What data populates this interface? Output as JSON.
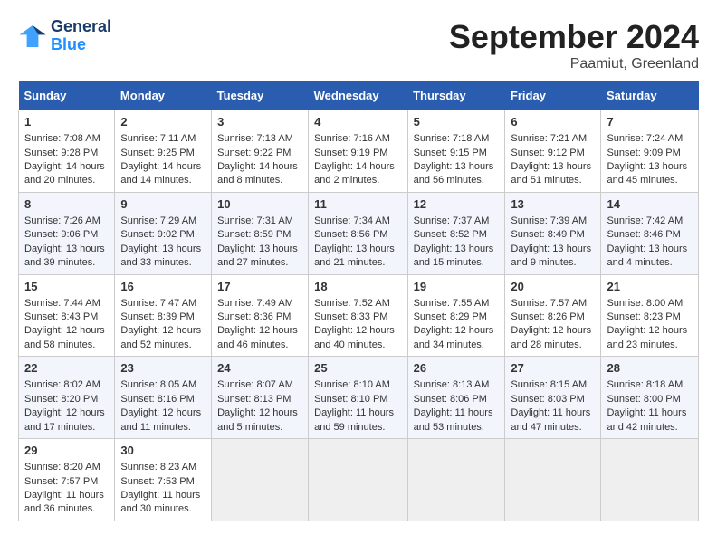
{
  "header": {
    "logo_line1": "General",
    "logo_line2": "Blue",
    "month_title": "September 2024",
    "location": "Paamiut, Greenland"
  },
  "columns": [
    "Sunday",
    "Monday",
    "Tuesday",
    "Wednesday",
    "Thursday",
    "Friday",
    "Saturday"
  ],
  "weeks": [
    [
      {
        "day": "1",
        "sunrise": "7:08 AM",
        "sunset": "9:28 PM",
        "daylight": "14 hours and 20 minutes."
      },
      {
        "day": "2",
        "sunrise": "7:11 AM",
        "sunset": "9:25 PM",
        "daylight": "14 hours and 14 minutes."
      },
      {
        "day": "3",
        "sunrise": "7:13 AM",
        "sunset": "9:22 PM",
        "daylight": "14 hours and 8 minutes."
      },
      {
        "day": "4",
        "sunrise": "7:16 AM",
        "sunset": "9:19 PM",
        "daylight": "14 hours and 2 minutes."
      },
      {
        "day": "5",
        "sunrise": "7:18 AM",
        "sunset": "9:15 PM",
        "daylight": "13 hours and 56 minutes."
      },
      {
        "day": "6",
        "sunrise": "7:21 AM",
        "sunset": "9:12 PM",
        "daylight": "13 hours and 51 minutes."
      },
      {
        "day": "7",
        "sunrise": "7:24 AM",
        "sunset": "9:09 PM",
        "daylight": "13 hours and 45 minutes."
      }
    ],
    [
      {
        "day": "8",
        "sunrise": "7:26 AM",
        "sunset": "9:06 PM",
        "daylight": "13 hours and 39 minutes."
      },
      {
        "day": "9",
        "sunrise": "7:29 AM",
        "sunset": "9:02 PM",
        "daylight": "13 hours and 33 minutes."
      },
      {
        "day": "10",
        "sunrise": "7:31 AM",
        "sunset": "8:59 PM",
        "daylight": "13 hours and 27 minutes."
      },
      {
        "day": "11",
        "sunrise": "7:34 AM",
        "sunset": "8:56 PM",
        "daylight": "13 hours and 21 minutes."
      },
      {
        "day": "12",
        "sunrise": "7:37 AM",
        "sunset": "8:52 PM",
        "daylight": "13 hours and 15 minutes."
      },
      {
        "day": "13",
        "sunrise": "7:39 AM",
        "sunset": "8:49 PM",
        "daylight": "13 hours and 9 minutes."
      },
      {
        "day": "14",
        "sunrise": "7:42 AM",
        "sunset": "8:46 PM",
        "daylight": "13 hours and 4 minutes."
      }
    ],
    [
      {
        "day": "15",
        "sunrise": "7:44 AM",
        "sunset": "8:43 PM",
        "daylight": "12 hours and 58 minutes."
      },
      {
        "day": "16",
        "sunrise": "7:47 AM",
        "sunset": "8:39 PM",
        "daylight": "12 hours and 52 minutes."
      },
      {
        "day": "17",
        "sunrise": "7:49 AM",
        "sunset": "8:36 PM",
        "daylight": "12 hours and 46 minutes."
      },
      {
        "day": "18",
        "sunrise": "7:52 AM",
        "sunset": "8:33 PM",
        "daylight": "12 hours and 40 minutes."
      },
      {
        "day": "19",
        "sunrise": "7:55 AM",
        "sunset": "8:29 PM",
        "daylight": "12 hours and 34 minutes."
      },
      {
        "day": "20",
        "sunrise": "7:57 AM",
        "sunset": "8:26 PM",
        "daylight": "12 hours and 28 minutes."
      },
      {
        "day": "21",
        "sunrise": "8:00 AM",
        "sunset": "8:23 PM",
        "daylight": "12 hours and 23 minutes."
      }
    ],
    [
      {
        "day": "22",
        "sunrise": "8:02 AM",
        "sunset": "8:20 PM",
        "daylight": "12 hours and 17 minutes."
      },
      {
        "day": "23",
        "sunrise": "8:05 AM",
        "sunset": "8:16 PM",
        "daylight": "12 hours and 11 minutes."
      },
      {
        "day": "24",
        "sunrise": "8:07 AM",
        "sunset": "8:13 PM",
        "daylight": "12 hours and 5 minutes."
      },
      {
        "day": "25",
        "sunrise": "8:10 AM",
        "sunset": "8:10 PM",
        "daylight": "11 hours and 59 minutes."
      },
      {
        "day": "26",
        "sunrise": "8:13 AM",
        "sunset": "8:06 PM",
        "daylight": "11 hours and 53 minutes."
      },
      {
        "day": "27",
        "sunrise": "8:15 AM",
        "sunset": "8:03 PM",
        "daylight": "11 hours and 47 minutes."
      },
      {
        "day": "28",
        "sunrise": "8:18 AM",
        "sunset": "8:00 PM",
        "daylight": "11 hours and 42 minutes."
      }
    ],
    [
      {
        "day": "29",
        "sunrise": "8:20 AM",
        "sunset": "7:57 PM",
        "daylight": "11 hours and 36 minutes."
      },
      {
        "day": "30",
        "sunrise": "8:23 AM",
        "sunset": "7:53 PM",
        "daylight": "11 hours and 30 minutes."
      },
      null,
      null,
      null,
      null,
      null
    ]
  ],
  "labels": {
    "sunrise_label": "Sunrise:",
    "sunset_label": "Sunset:",
    "daylight_label": "Daylight:"
  }
}
